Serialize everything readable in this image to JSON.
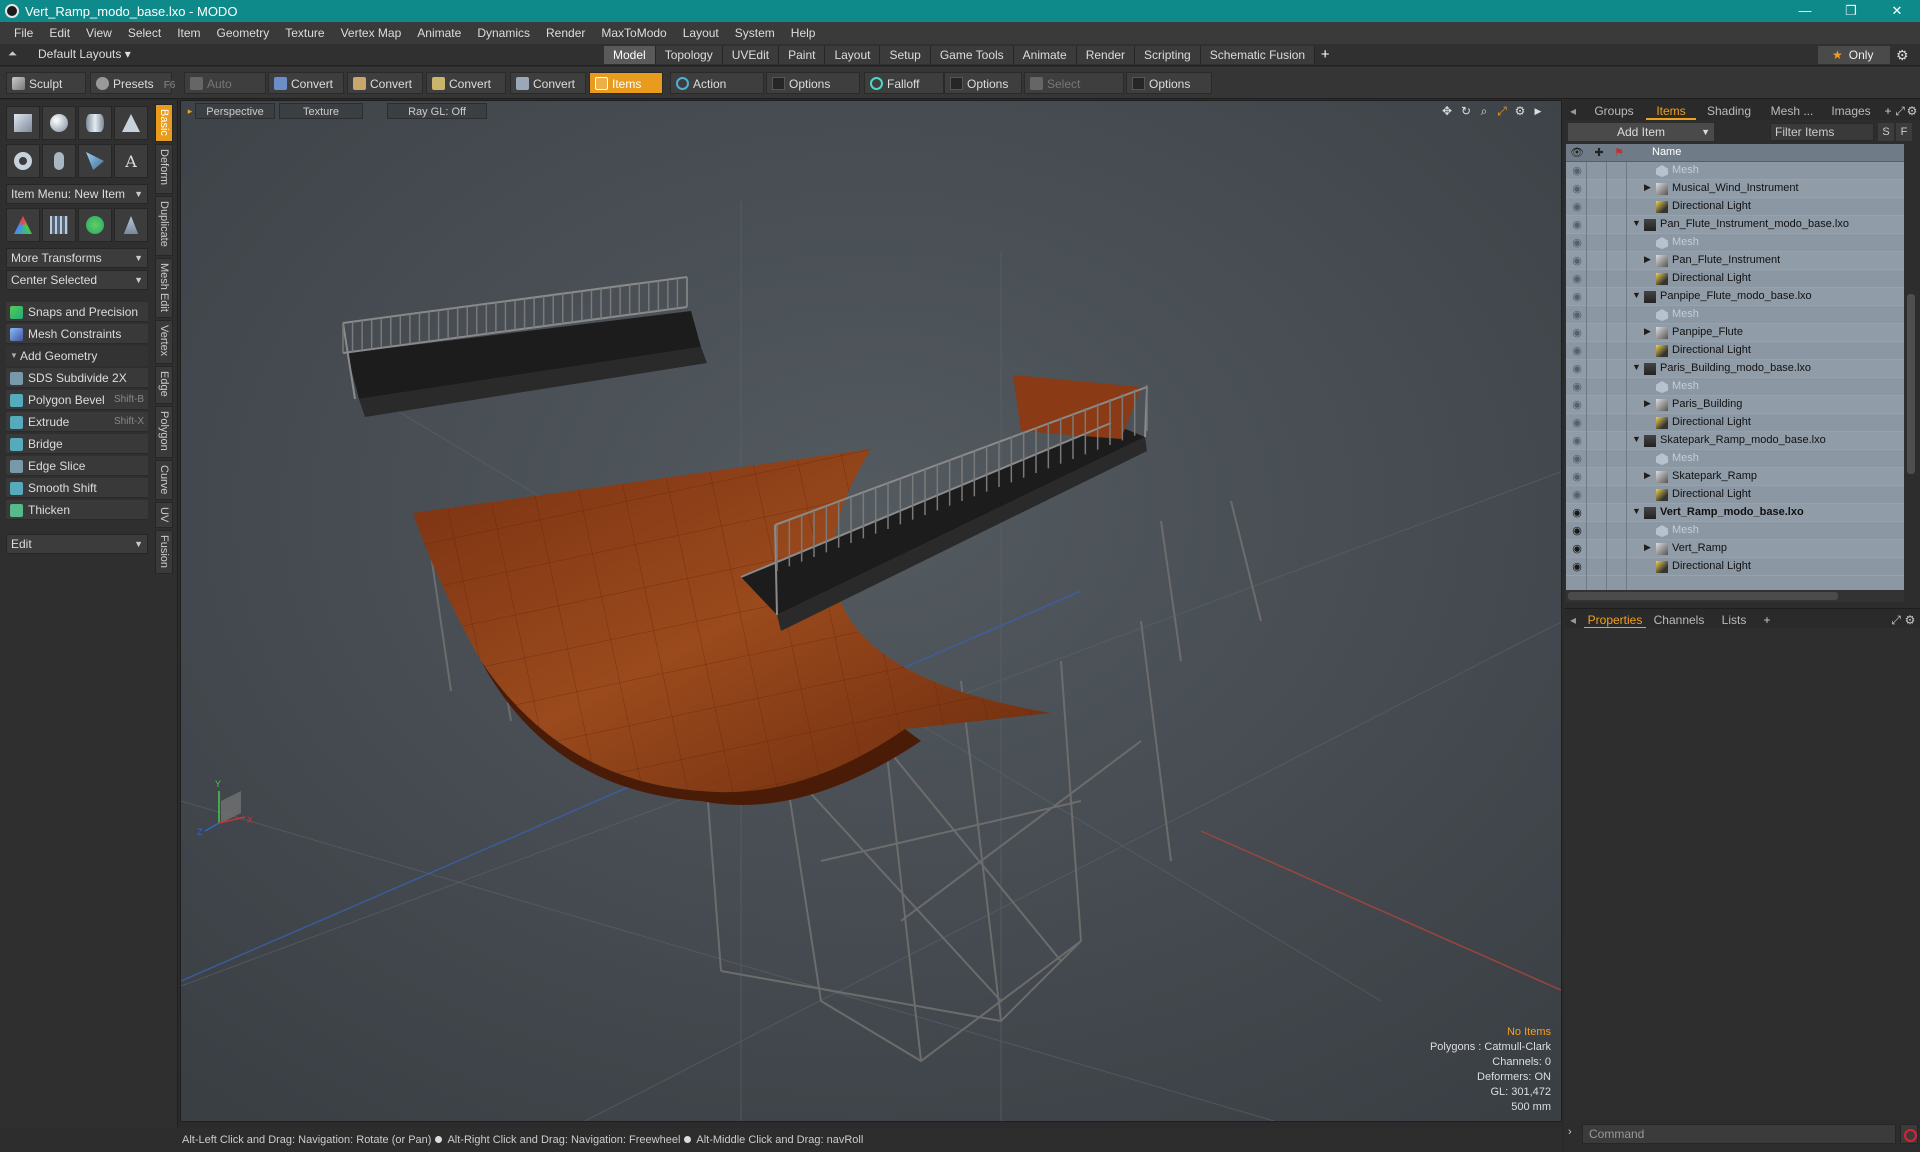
{
  "window": {
    "title": "Vert_Ramp_modo_base.lxo - MODO",
    "min": "—",
    "max": "❐",
    "close": "✕"
  },
  "menu": [
    "File",
    "Edit",
    "View",
    "Select",
    "Item",
    "Geometry",
    "Texture",
    "Vertex Map",
    "Animate",
    "Dynamics",
    "Render",
    "MaxToModo",
    "Layout",
    "System",
    "Help"
  ],
  "layoutbar": {
    "default_layouts": "Default Layouts ▾",
    "tabs": [
      "Model",
      "Topology",
      "UVEdit",
      "Paint",
      "Layout",
      "Setup",
      "Game Tools",
      "Animate",
      "Render",
      "Scripting",
      "Schematic Fusion"
    ],
    "active_tab": "Model",
    "add": "+",
    "only": "Only"
  },
  "toolbar": {
    "sculpt": "Sculpt",
    "presets": "Presets",
    "presets_key": "F6",
    "auto_select": "Auto Select",
    "convert1": "Convert",
    "convert2": "Convert",
    "convert3": "Convert",
    "convert4": "Convert",
    "items": "Items",
    "action_center": "Action Center",
    "options1": "Options",
    "falloff": "Falloff",
    "options2": "Options",
    "select_through": "Select Through",
    "options3": "Options"
  },
  "leftpanel": {
    "item_menu": "Item Menu: New Item",
    "more_transforms": "More Transforms",
    "center_selected": "Center Selected",
    "snaps": "Snaps and Precision",
    "mesh_constraints": "Mesh Constraints",
    "add_geometry": "Add Geometry",
    "tools": [
      {
        "label": "SDS Subdivide 2X",
        "key": ""
      },
      {
        "label": "Polygon Bevel",
        "key": "Shift-B"
      },
      {
        "label": "Extrude",
        "key": "Shift-X"
      },
      {
        "label": "Bridge",
        "key": ""
      },
      {
        "label": "Edge Slice",
        "key": ""
      },
      {
        "label": "Smooth Shift",
        "key": ""
      },
      {
        "label": "Thicken",
        "key": ""
      }
    ],
    "edit": "Edit",
    "vtabs": [
      "Basic",
      "Deform",
      "Duplicate",
      "Mesh Edit",
      "Vertex",
      "Edge",
      "Polygon",
      "Curve",
      "UV",
      "Fusion"
    ]
  },
  "viewport": {
    "perspective": "Perspective",
    "texture": "Texture",
    "raygl": "Ray GL: Off",
    "stats": {
      "no_items": "No Items",
      "polygons": "Polygons : Catmull-Clark",
      "channels": "Channels: 0",
      "deformers": "Deformers: ON",
      "gl": "GL: 301,472",
      "scale": "500 mm"
    },
    "axis_y": "Y",
    "axis_z": "Z",
    "axis_x": "X"
  },
  "statusbar": {
    "hint1": "Alt-Left Click and Drag: Navigation: Rotate (or Pan)",
    "hint2": "Alt-Right Click and Drag: Navigation: Freewheel",
    "hint3": "Alt-Middle Click and Drag: navRoll"
  },
  "rightpanel": {
    "tabs": [
      "Groups",
      "Items",
      "Shading",
      "Mesh ...",
      "Images"
    ],
    "active_tab": "Items",
    "add_item": "Add Item",
    "filter_items": "Filter Items",
    "s_btn": "S",
    "f_btn": "F",
    "name_col": "Name",
    "tree": [
      {
        "label": "Mesh",
        "type": "mesh",
        "indent": 2,
        "dim": true,
        "eye": false
      },
      {
        "label": "Musical_Wind_Instrument",
        "type": "item",
        "indent": 2,
        "expand": "▶",
        "eye": false
      },
      {
        "label": "Directional Light",
        "type": "light",
        "indent": 2,
        "eye": false
      },
      {
        "label": "Pan_Flute_Instrument_modo_base.lxo",
        "type": "scene",
        "indent": 1,
        "expand": "▼",
        "eye": false
      },
      {
        "label": "Mesh",
        "type": "mesh",
        "indent": 2,
        "dim": true,
        "eye": false
      },
      {
        "label": "Pan_Flute_Instrument",
        "type": "item",
        "indent": 2,
        "expand": "▶",
        "eye": false
      },
      {
        "label": "Directional Light",
        "type": "light",
        "indent": 2,
        "eye": false
      },
      {
        "label": "Panpipe_Flute_modo_base.lxo",
        "type": "scene",
        "indent": 1,
        "expand": "▼",
        "eye": false
      },
      {
        "label": "Mesh",
        "type": "mesh",
        "indent": 2,
        "dim": true,
        "eye": false
      },
      {
        "label": "Panpipe_Flute",
        "type": "item",
        "indent": 2,
        "expand": "▶",
        "eye": false
      },
      {
        "label": "Directional Light",
        "type": "light",
        "indent": 2,
        "eye": false
      },
      {
        "label": "Paris_Building_modo_base.lxo",
        "type": "scene",
        "indent": 1,
        "expand": "▼",
        "eye": false
      },
      {
        "label": "Mesh",
        "type": "mesh",
        "indent": 2,
        "dim": true,
        "eye": false
      },
      {
        "label": "Paris_Building",
        "type": "item",
        "indent": 2,
        "expand": "▶",
        "eye": false
      },
      {
        "label": "Directional Light",
        "type": "light",
        "indent": 2,
        "eye": false
      },
      {
        "label": "Skatepark_Ramp_modo_base.lxo",
        "type": "scene",
        "indent": 1,
        "expand": "▼",
        "eye": false
      },
      {
        "label": "Mesh",
        "type": "mesh",
        "indent": 2,
        "dim": true,
        "eye": false
      },
      {
        "label": "Skatepark_Ramp",
        "type": "item",
        "indent": 2,
        "expand": "▶",
        "eye": false
      },
      {
        "label": "Directional Light",
        "type": "light",
        "indent": 2,
        "eye": false
      },
      {
        "label": "Vert_Ramp_modo_base.lxo",
        "type": "scene",
        "indent": 1,
        "expand": "▼",
        "bold": true,
        "eye": true
      },
      {
        "label": "Mesh",
        "type": "mesh",
        "indent": 2,
        "dim": true,
        "eye": true
      },
      {
        "label": "Vert_Ramp",
        "type": "item",
        "indent": 2,
        "expand": "▶",
        "eye": true
      },
      {
        "label": "Directional Light",
        "type": "light",
        "indent": 2,
        "eye": true
      }
    ],
    "props_tabs": [
      "Properties",
      "Channels",
      "Lists"
    ],
    "props_active": "Properties",
    "props_add": "+",
    "command_placeholder": "Command"
  },
  "colors": {
    "accent": "#e89b1c",
    "titlebar": "#0f8a8a",
    "ramp_wood": "#8a3a14",
    "viewport_bg": "#474d52",
    "tree_bg": "#8b97a3"
  }
}
